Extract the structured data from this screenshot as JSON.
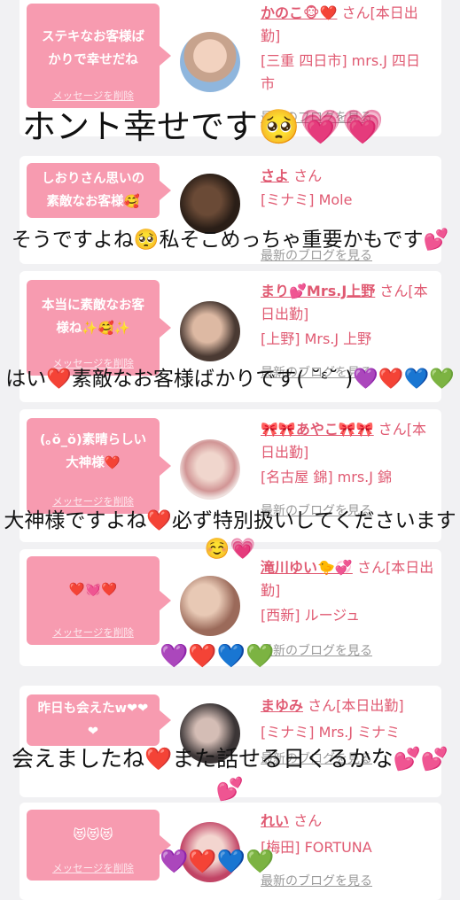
{
  "cards": [
    {
      "message": "ステキなお客様ばかりで幸せだね",
      "delete_label": "メッセージを削除",
      "name": "かのこ🐵❤️",
      "suffix": "さん[本日出勤]",
      "shop": "[三重 四日市] mrs.J 四日市",
      "blog_label": "最新のブログを見る"
    },
    {
      "message": "しおりさん思いの素敵なお客様🥰",
      "delete_label": "",
      "name": "さよ",
      "suffix": "さん",
      "shop": "[ミナミ] Mole",
      "blog_label": "最新のブログを見る"
    },
    {
      "message": "本当に素敵なお客様ね✨🥰✨",
      "delete_label": "メッセージを削除",
      "name": "まり💕Mrs.J上野",
      "suffix": "さん[本日出勤]",
      "shop": "[上野] Mrs.J 上野",
      "blog_label": "最新のブログを見る"
    },
    {
      "message": "(｡ŏ_ŏ)素晴らしい大神様❤️",
      "delete_label": "メッセージを削除",
      "name": "🎀🎀あやこ🎀🎀",
      "suffix": "さん[本日出勤]",
      "shop": "[名古屋 錦] mrs.J 錦",
      "blog_label": "最新のブログを見る"
    },
    {
      "message": "❤️💓❤️",
      "delete_label": "メッセージを削除",
      "name": "滝川ゆい🐤💞",
      "suffix": "さん[本日出勤]",
      "shop": "[西新] ルージュ",
      "blog_label": "最新のブログを見る"
    },
    {
      "message": "昨日も会えたw❤❤❤",
      "delete_label": "",
      "name": "まゆみ",
      "suffix": "さん[本日出勤]",
      "shop": "[ミナミ] Mrs.J ミナミ",
      "blog_label": "最新のブログを見る"
    },
    {
      "message": "😻😻😻",
      "delete_label": "メッセージを削除",
      "name": "れい",
      "suffix": "さん",
      "shop": "[梅田] FORTUNA",
      "blog_label": "最新のブログを見る"
    }
  ],
  "overlays": {
    "t1": "ホント幸せです🥺💗💗",
    "t2": "そうですよね🥺私そこめっちゃ重要かもです💕",
    "t3": "はい❤️素敵なお客様ばかりです( ˘ᵋ˘ )💜❤️💙💚",
    "t4": "大神様ですよね❤️必ず特別扱いしてくださいます☺️💗",
    "t5": "会えましたね❤️また話せる日くるかな💕💕💕",
    "hearts1": "💜❤️💙💚",
    "hearts2": "💜❤️💙💚"
  },
  "colors": {
    "bubble": "#f79bb0",
    "name": "#e05a72",
    "background": "#f1f1f3"
  }
}
